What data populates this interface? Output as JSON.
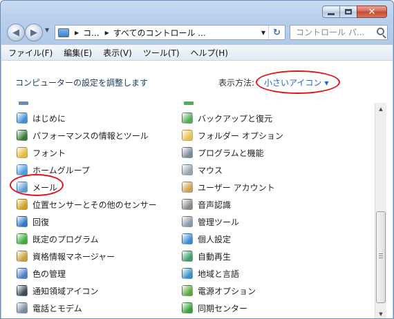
{
  "window": {
    "colors": {
      "frame": "#b7cfeb",
      "close": "#c44a33",
      "link": "#2266cc",
      "annotation": "#e0141a"
    }
  },
  "address": {
    "crumbs": [
      "コ...",
      "すべてのコントロール ..."
    ],
    "search_placeholder": "コントロール パ..."
  },
  "menu": {
    "items": [
      "ファイル(F)",
      "編集(E)",
      "表示(V)",
      "ツール(T)",
      "ヘルプ(H)"
    ]
  },
  "content": {
    "title": "コンピューターの設定を調整します",
    "view_by_label": "表示方法:",
    "view_by_value": "小さいアイコン",
    "left_items": [
      {
        "label": "はじめに",
        "icon": "getting-started-icon",
        "color": "#3f8fd6"
      },
      {
        "label": "パフォーマンスの情報とツール",
        "icon": "performance-icon",
        "color": "#3a7a3a"
      },
      {
        "label": "フォント",
        "icon": "fonts-icon",
        "color": "#e3b93c"
      },
      {
        "label": "ホームグループ",
        "icon": "homegroup-icon",
        "color": "#4a9be0"
      },
      {
        "label": "メール",
        "icon": "mail-icon",
        "color": "#5aa0d8"
      },
      {
        "label": "位置センサーとその他のセンサー",
        "icon": "sensor-icon",
        "color": "#c9a227"
      },
      {
        "label": "回復",
        "icon": "recovery-icon",
        "color": "#2f78c8"
      },
      {
        "label": "既定のプログラム",
        "icon": "default-programs-icon",
        "color": "#3faa3f"
      },
      {
        "label": "資格情報マネージャー",
        "icon": "credential-manager-icon",
        "color": "#c8a03c"
      },
      {
        "label": "色の管理",
        "icon": "color-management-icon",
        "color": "#4a7fc8"
      },
      {
        "label": "通知領域アイコン",
        "icon": "notification-icons-icon",
        "color": "#3a4a5a"
      },
      {
        "label": "電話とモデム",
        "icon": "phone-modem-icon",
        "color": "#7a8a9a"
      }
    ],
    "right_items": [
      {
        "label": "バックアップと復元",
        "icon": "backup-icon",
        "color": "#4caf50"
      },
      {
        "label": "フォルダー オプション",
        "icon": "folder-options-icon",
        "color": "#e8c24a"
      },
      {
        "label": "プログラムと機能",
        "icon": "programs-features-icon",
        "color": "#7a8a99"
      },
      {
        "label": "マウス",
        "icon": "mouse-icon",
        "color": "#9aa4b0"
      },
      {
        "label": "ユーザー アカウント",
        "icon": "user-accounts-icon",
        "color": "#d4a24a"
      },
      {
        "label": "音声認識",
        "icon": "speech-recognition-icon",
        "color": "#8a8a8a"
      },
      {
        "label": "管理ツール",
        "icon": "admin-tools-icon",
        "color": "#8899aa"
      },
      {
        "label": "個人設定",
        "icon": "personalization-icon",
        "color": "#3a8ad8"
      },
      {
        "label": "自動再生",
        "icon": "autoplay-icon",
        "color": "#3aa06a"
      },
      {
        "label": "地域と言語",
        "icon": "region-language-icon",
        "color": "#3a90c8"
      },
      {
        "label": "電源オプション",
        "icon": "power-options-icon",
        "color": "#5aaa3a"
      },
      {
        "label": "同期センター",
        "icon": "sync-center-icon",
        "color": "#3aa03a"
      }
    ]
  }
}
